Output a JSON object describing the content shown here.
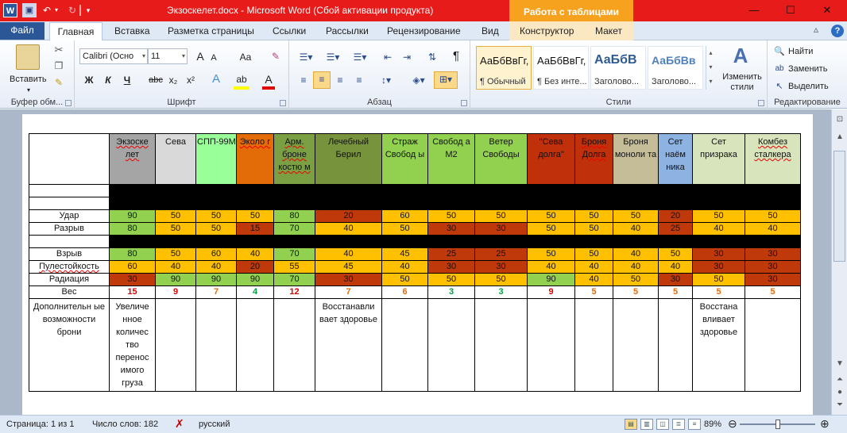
{
  "window": {
    "title": "Экзоскелет.docx  -  Microsoft Word (Сбой активации продукта)",
    "context_header": "Работа с таблицами",
    "minimize": "—",
    "maximize": "☐",
    "close": "✕"
  },
  "qat": {
    "app": "W",
    "save": "▣",
    "undo": "↶",
    "undo_drop": "▾",
    "redo": "↻",
    "more": "▾"
  },
  "tabs": [
    "Файл",
    "Главная",
    "Вставка",
    "Разметка страницы",
    "Ссылки",
    "Рассылки",
    "Рецензирование",
    "Вид",
    "Конструктор",
    "Макет"
  ],
  "tab_right": {
    "collapse": "▵",
    "help": "?"
  },
  "ribbon": {
    "clipboard": {
      "label": "Буфер обм...",
      "paste": "Вставить"
    },
    "font": {
      "label": "Шрифт",
      "name": "Calibri (Осно",
      "size": "11",
      "grow": "A",
      "shrink": "A",
      "case": "Aa",
      "clear": "✎",
      "bold": "Ж",
      "italic": "К",
      "underline": "Ч",
      "strike": "abc",
      "sub": "x₂",
      "sup": "x²",
      "effects": "A",
      "highlight": "ab",
      "color": "A"
    },
    "paragraph": {
      "label": "Абзац",
      "pilcrow": "¶"
    },
    "styles": {
      "label": "Стили",
      "items": [
        {
          "sample": "АаБбВвГг,",
          "name": "¶ Обычный"
        },
        {
          "sample": "АаБбВвГг,",
          "name": "¶ Без инте..."
        },
        {
          "sample": "АаБбВ",
          "name": "Заголово..."
        },
        {
          "sample": "АаБбВв",
          "name": "Заголово..."
        }
      ],
      "change": "Изменить стили"
    },
    "editing": {
      "label": "Редактирование",
      "find": "Найти",
      "replace": "Заменить",
      "select": "Выделить"
    }
  },
  "table": {
    "headers": [
      "",
      "Экзоске лет",
      "Сева",
      "СПП-99М",
      "Эколо г",
      "Арм. броне костю м",
      "Лечебный Берил",
      "Страж Свобод ы",
      "Свобод а М2",
      "Ветер Свободы",
      "\"Сева долга\"",
      "Броня Долга",
      "Броня моноли та",
      "Сет наём ника",
      "Сет призрака",
      "Комбез сталкера"
    ],
    "header_colors": [
      "#ffffff",
      "#a5a5a5",
      "#d9d9d9",
      "#99ff99",
      "#e36c09",
      "#7aa043",
      "#77933c",
      "#92d050",
      "#92d050",
      "#92d050",
      "#c0300a",
      "#c0300a",
      "#c4bd97",
      "#8db3e2",
      "#d7e4bc",
      "#d7e4bc"
    ],
    "rows": [
      {
        "label": "Удар",
        "values": [
          "90",
          "50",
          "50",
          "50",
          "80",
          "20",
          "60",
          "50",
          "50",
          "50",
          "50",
          "50",
          "20",
          "50",
          "50"
        ]
      },
      {
        "label": "Разрыв",
        "values": [
          "80",
          "50",
          "50",
          "15",
          "70",
          "40",
          "50",
          "30",
          "30",
          "50",
          "50",
          "40",
          "25",
          "40",
          "40"
        ]
      },
      {
        "label": "Взрыв",
        "values": [
          "80",
          "50",
          "60",
          "40",
          "70",
          "40",
          "45",
          "25",
          "25",
          "50",
          "50",
          "40",
          "50",
          "30",
          "30"
        ]
      },
      {
        "label": "Пулестойкость",
        "values": [
          "60",
          "40",
          "40",
          "20",
          "55",
          "45",
          "40",
          "30",
          "30",
          "40",
          "40",
          "40",
          "40",
          "30",
          "30"
        ]
      },
      {
        "label": "Радиация",
        "values": [
          "30",
          "90",
          "90",
          "90",
          "70",
          "30",
          "50",
          "50",
          "50",
          "90",
          "40",
          "50",
          "30",
          "50",
          "30"
        ]
      }
    ],
    "weight": {
      "label": "Вес",
      "values": [
        "15",
        "9",
        "7",
        "4",
        "12",
        "7",
        "6",
        "3",
        "3",
        "9",
        "5",
        "5",
        "5",
        "5",
        "5"
      ]
    },
    "extra": {
      "label": "Дополнительн ые возможности брони",
      "values": [
        "Увеличе нное количес тво перенос имого груза",
        "",
        "",
        "",
        "",
        "Восстанавли вает здоровье",
        "",
        "",
        "",
        "",
        "",
        "",
        "",
        "Восстана вливает здоровье",
        ""
      ]
    },
    "value_colors": {
      "90": "#92d050",
      "80": "#92d050",
      "70": "#92d050",
      "60": "#ffc000",
      "55": "#ffc000",
      "50": "#ffc000",
      "45": "#ffc000",
      "40": "#ffc000",
      "30": "#c0390b",
      "25": "#c0390b",
      "20": "#c0390b",
      "15": "#c0390b"
    },
    "weight_colors": {
      "15": "#e00000",
      "12": "#e00000",
      "9": "#e00000",
      "7": "#e46c0a",
      "6": "#e46c0a",
      "5": "#e46c0a",
      "4": "#00a040",
      "3": "#00a040"
    }
  },
  "status": {
    "page": "Страница: 1 из 1",
    "words": "Число слов: 182",
    "lang": "русский",
    "zoom": "89%",
    "zoom_level": 0.5
  }
}
